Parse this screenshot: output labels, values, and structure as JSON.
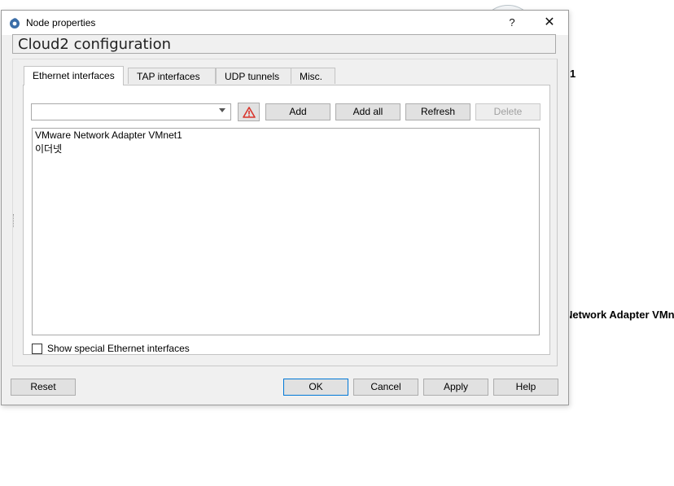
{
  "background": {
    "fragment_1": "1",
    "fragment_2": "Network Adapter VMn"
  },
  "window": {
    "title": "Node properties",
    "help_glyph": "?",
    "close_glyph": "✕"
  },
  "header": {
    "title": "Cloud2 configuration"
  },
  "tabs": [
    {
      "label": "Ethernet interfaces",
      "active": true
    },
    {
      "label": "TAP interfaces",
      "active": false
    },
    {
      "label": "UDP tunnels",
      "active": false
    },
    {
      "label": "Misc.",
      "active": false
    }
  ],
  "toolbar": {
    "combo_value": "",
    "add_label": "Add",
    "add_all_label": "Add all",
    "refresh_label": "Refresh",
    "delete_label": "Delete",
    "warning_icon": "warning-triangle-icon",
    "warning_color": "#d9342b"
  },
  "interfaces": [
    "VMware Network Adapter VMnet1",
    "이더넷"
  ],
  "options": {
    "show_special_label": "Show special Ethernet interfaces",
    "show_special_checked": false
  },
  "footer": {
    "reset_label": "Reset",
    "ok_label": "OK",
    "cancel_label": "Cancel",
    "apply_label": "Apply",
    "help_label": "Help"
  },
  "colors": {
    "accent": "#0078d7",
    "dialog_bg": "#f0f0f0"
  }
}
